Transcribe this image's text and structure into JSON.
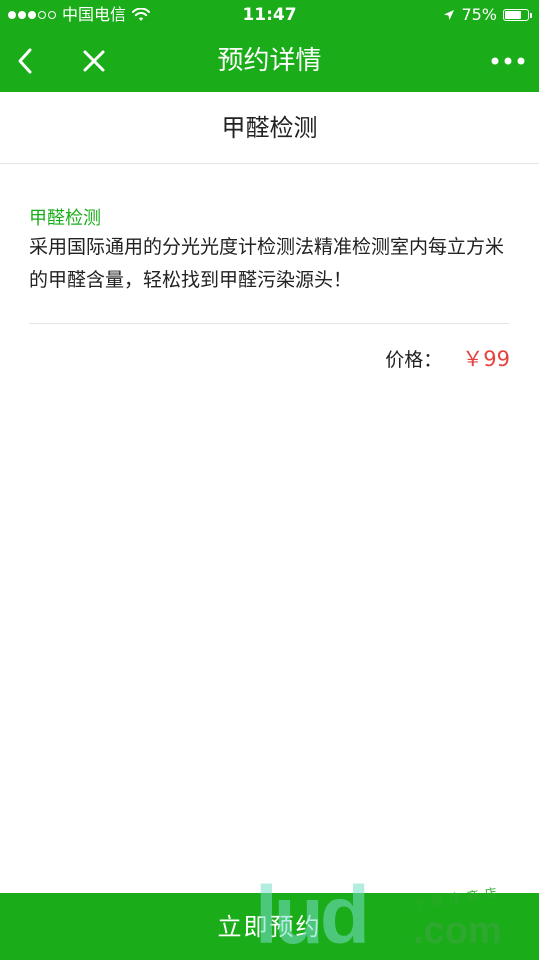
{
  "status_bar": {
    "carrier": "中国电信",
    "time": "11:47",
    "battery": "75%",
    "battery_level": 0.75,
    "signal_bars_filled": 3,
    "signal_bars_total": 5,
    "icons": [
      "signal-dots-icon",
      "wifi-icon",
      "location-arrow-icon",
      "battery-icon"
    ]
  },
  "navbar": {
    "title": "预约详情",
    "left_icons": [
      "chevron-left-icon",
      "close-icon"
    ],
    "right_icon": "more-dots-icon",
    "color": "#1aad19"
  },
  "section": {
    "title": "甲醛检测"
  },
  "item": {
    "name": "甲醛检测",
    "description": "采用国际通用的分光光度计检测法精准检测室内每立方米的甲醛含量，轻松找到甲醛污染源头！",
    "price_label": "价格：",
    "price_value": "￥99"
  },
  "actions": {
    "book_label": "立即预约"
  },
  "watermark": {
    "text_big": "lud",
    "text_com": ".com",
    "text_small": "小程序商店"
  },
  "colors": {
    "accent": "#1aad19",
    "price": "#e64340",
    "text": "#222222"
  }
}
